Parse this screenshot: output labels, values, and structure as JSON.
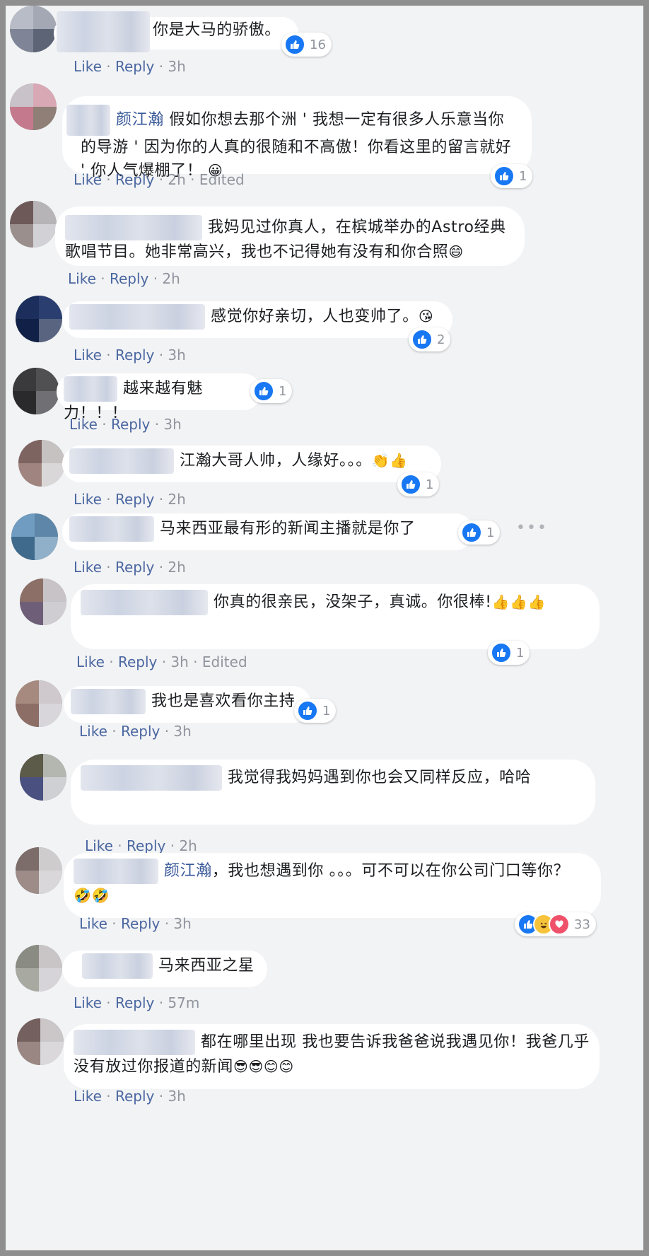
{
  "colors": {
    "link": "#4b67a1",
    "meta": "#90949c",
    "like_blue": "#1877f2",
    "mention": "#385898"
  },
  "comments": [
    {
      "text": "你是大马的骄傲。",
      "reaction_count": "16",
      "actions": {
        "like": "Like",
        "reply": "Reply",
        "time": "3h"
      }
    },
    {
      "mention": "颜江瀚",
      "text": " 假如你想去那个洲 ' 我想一定有很多人乐意当你的导游 ' 因为你的人真的很随和不高傲！你看这里的留言就好 ' 你人气爆棚了！",
      "emoji": "😀",
      "reaction_count": "1",
      "actions": {
        "like": "Like",
        "reply": "Reply",
        "time": "2h",
        "edited": "Edited"
      }
    },
    {
      "text": "我妈见过你真人，在槟城举办的Astro经典歌唱节目。她非常高兴，我也不记得她有没有和你合照",
      "emoji": "😄",
      "actions": {
        "like": "Like",
        "reply": "Reply",
        "time": "2h"
      }
    },
    {
      "text": "感觉你好亲切，人也变帅了。",
      "emoji": "😘",
      "reaction_count": "2",
      "actions": {
        "like": "Like",
        "reply": "Reply",
        "time": "3h"
      }
    },
    {
      "text": "越来越有魅力！！！",
      "reaction_count": "1",
      "actions": {
        "like": "Like",
        "reply": "Reply",
        "time": "3h"
      }
    },
    {
      "text": "江瀚大哥人帅，人缘好。。。",
      "emoji": "👏👍",
      "reaction_count": "1",
      "actions": {
        "like": "Like",
        "reply": "Reply",
        "time": "2h"
      }
    },
    {
      "text": "马来西亚最有形的新闻主播就是你了",
      "reaction_count": "1",
      "actions": {
        "like": "Like",
        "reply": "Reply",
        "time": "2h"
      }
    },
    {
      "text": "你真的很亲民，没架子，真诚。你很棒!",
      "emoji": "👍👍👍",
      "reaction_count": "1",
      "actions": {
        "like": "Like",
        "reply": "Reply",
        "time": "3h",
        "edited": "Edited"
      }
    },
    {
      "text": "我也是喜欢看你主持",
      "reaction_count": "1",
      "actions": {
        "like": "Like",
        "reply": "Reply",
        "time": "3h"
      }
    },
    {
      "text": "我觉得我妈妈遇到你也会又同样反应，哈哈",
      "actions": {
        "like": "Like",
        "reply": "Reply",
        "time": "2h"
      }
    },
    {
      "mention": "颜江瀚",
      "text": "，我也想遇到你 。。。可不可以在你公司门口等你？",
      "emoji": "🤣🤣",
      "reaction_count": "33",
      "actions": {
        "like": "Like",
        "reply": "Reply",
        "time": "3h"
      }
    },
    {
      "text": "马来西亚之星",
      "actions": {
        "like": "Like",
        "reply": "Reply",
        "time": "57m"
      }
    },
    {
      "text": "都在哪里出现 我也要告诉我爸爸说我遇见你！我爸几乎没有放过你报道的新闻",
      "emoji": "😎😎😊😊",
      "actions": {
        "like": "Like",
        "reply": "Reply",
        "time": "3h"
      }
    }
  ],
  "icons": {
    "like": "thumbs-up-icon",
    "haha": "haha-face-icon",
    "love": "heart-icon",
    "more": "more-options-icon"
  }
}
